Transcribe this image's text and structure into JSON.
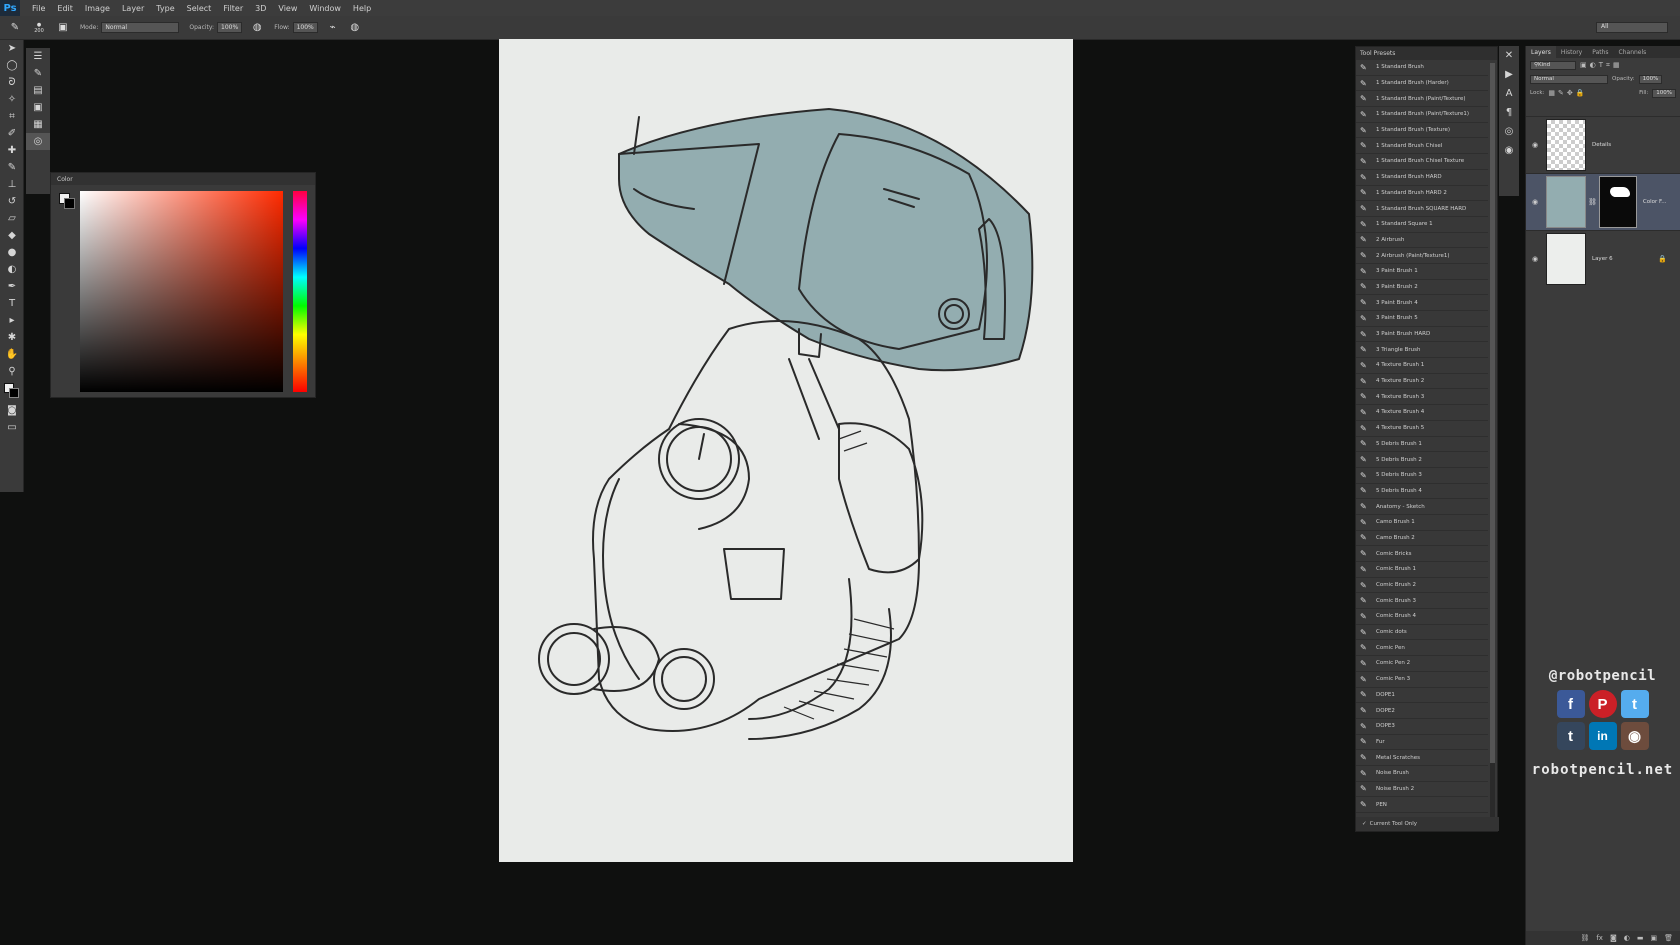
{
  "app": {
    "logo": "Ps"
  },
  "menu": [
    "File",
    "Edit",
    "Image",
    "Layer",
    "Type",
    "Select",
    "Filter",
    "3D",
    "View",
    "Window",
    "Help"
  ],
  "options": {
    "brush_size": "200",
    "mode_label": "Mode:",
    "mode_value": "Normal",
    "opacity_label": "Opacity:",
    "opacity_value": "100%",
    "flow_label": "Flow:",
    "flow_value": "100%",
    "workspace": "All"
  },
  "color_panel": {
    "title": "Color",
    "fg_color": "#f0f0f0",
    "bg_color": "#000000"
  },
  "tool_presets": {
    "title": "Tool Presets",
    "items": [
      "1 Standard Brush",
      "1 Standard Brush (Harder)",
      "1 Standard Brush (Paint/Texture)",
      "1 Standard Brush (Paint/Texture1)",
      "1 Standard Brush (Texture)",
      "1 Standard Brush Chisel",
      "1 Standard Brush Chisel Texture",
      "1 Standard Brush HARD",
      "1 Standard Brush HARD 2",
      "1 Standard Brush SQUARE HARD",
      "1 Standard Square 1",
      "2 Airbrush",
      "2 Airbrush (Paint/Texture1)",
      "3 Paint Brush 1",
      "3 Paint Brush 2",
      "3 Paint Brush 4",
      "3 Paint Brush 5",
      "3 Paint Brush HARD",
      "3 Triangle Brush",
      "4 Texture Brush 1",
      "4 Texture Brush 2",
      "4 Texture Brush 3",
      "4 Texture Brush 4",
      "4 Texture Brush 5",
      "5 Debris Brush 1",
      "5 Debris Brush 2",
      "5 Debris Brush 3",
      "5 Debris Brush 4",
      "Anatomy - Sketch",
      "Camo Brush 1",
      "Camo Brush 2",
      "Comic Bricks",
      "Comic Brush 1",
      "Comic Brush 2",
      "Comic Brush 3",
      "Comic Brush 4",
      "Comic dots",
      "Comic Pen",
      "Comic Pen 2",
      "Comic Pen 3",
      "DOPE1",
      "DOPE2",
      "DOPE3",
      "Fur",
      "Metal Scratches",
      "Noise Brush",
      "Noise Brush 2",
      "PEN"
    ],
    "footer": "Current Tool Only"
  },
  "layers_panel": {
    "tabs": [
      "Layers",
      "History",
      "Paths",
      "Channels"
    ],
    "kind": "Kind",
    "blend": "Normal",
    "opacity_label": "Opacity:",
    "opacity_value": "100%",
    "lock_label": "Lock:",
    "fill_label": "Fill:",
    "fill_value": "100%",
    "layers": [
      {
        "name": "Details"
      },
      {
        "name": "Color F..."
      },
      {
        "name": "Layer 6"
      }
    ]
  },
  "branding": {
    "handle": "@robotpencil",
    "site": "robotpencil.net"
  },
  "social": [
    {
      "letter": "f",
      "color": "#3b5998"
    },
    {
      "letter": "P",
      "color": "#cb2027"
    },
    {
      "letter": "t",
      "color": "#55acee"
    },
    {
      "letter": "t",
      "color": "#35465c"
    },
    {
      "letter": "in",
      "color": "#0077b5"
    },
    {
      "letter": "◉",
      "color": "#6d4c3d"
    }
  ]
}
